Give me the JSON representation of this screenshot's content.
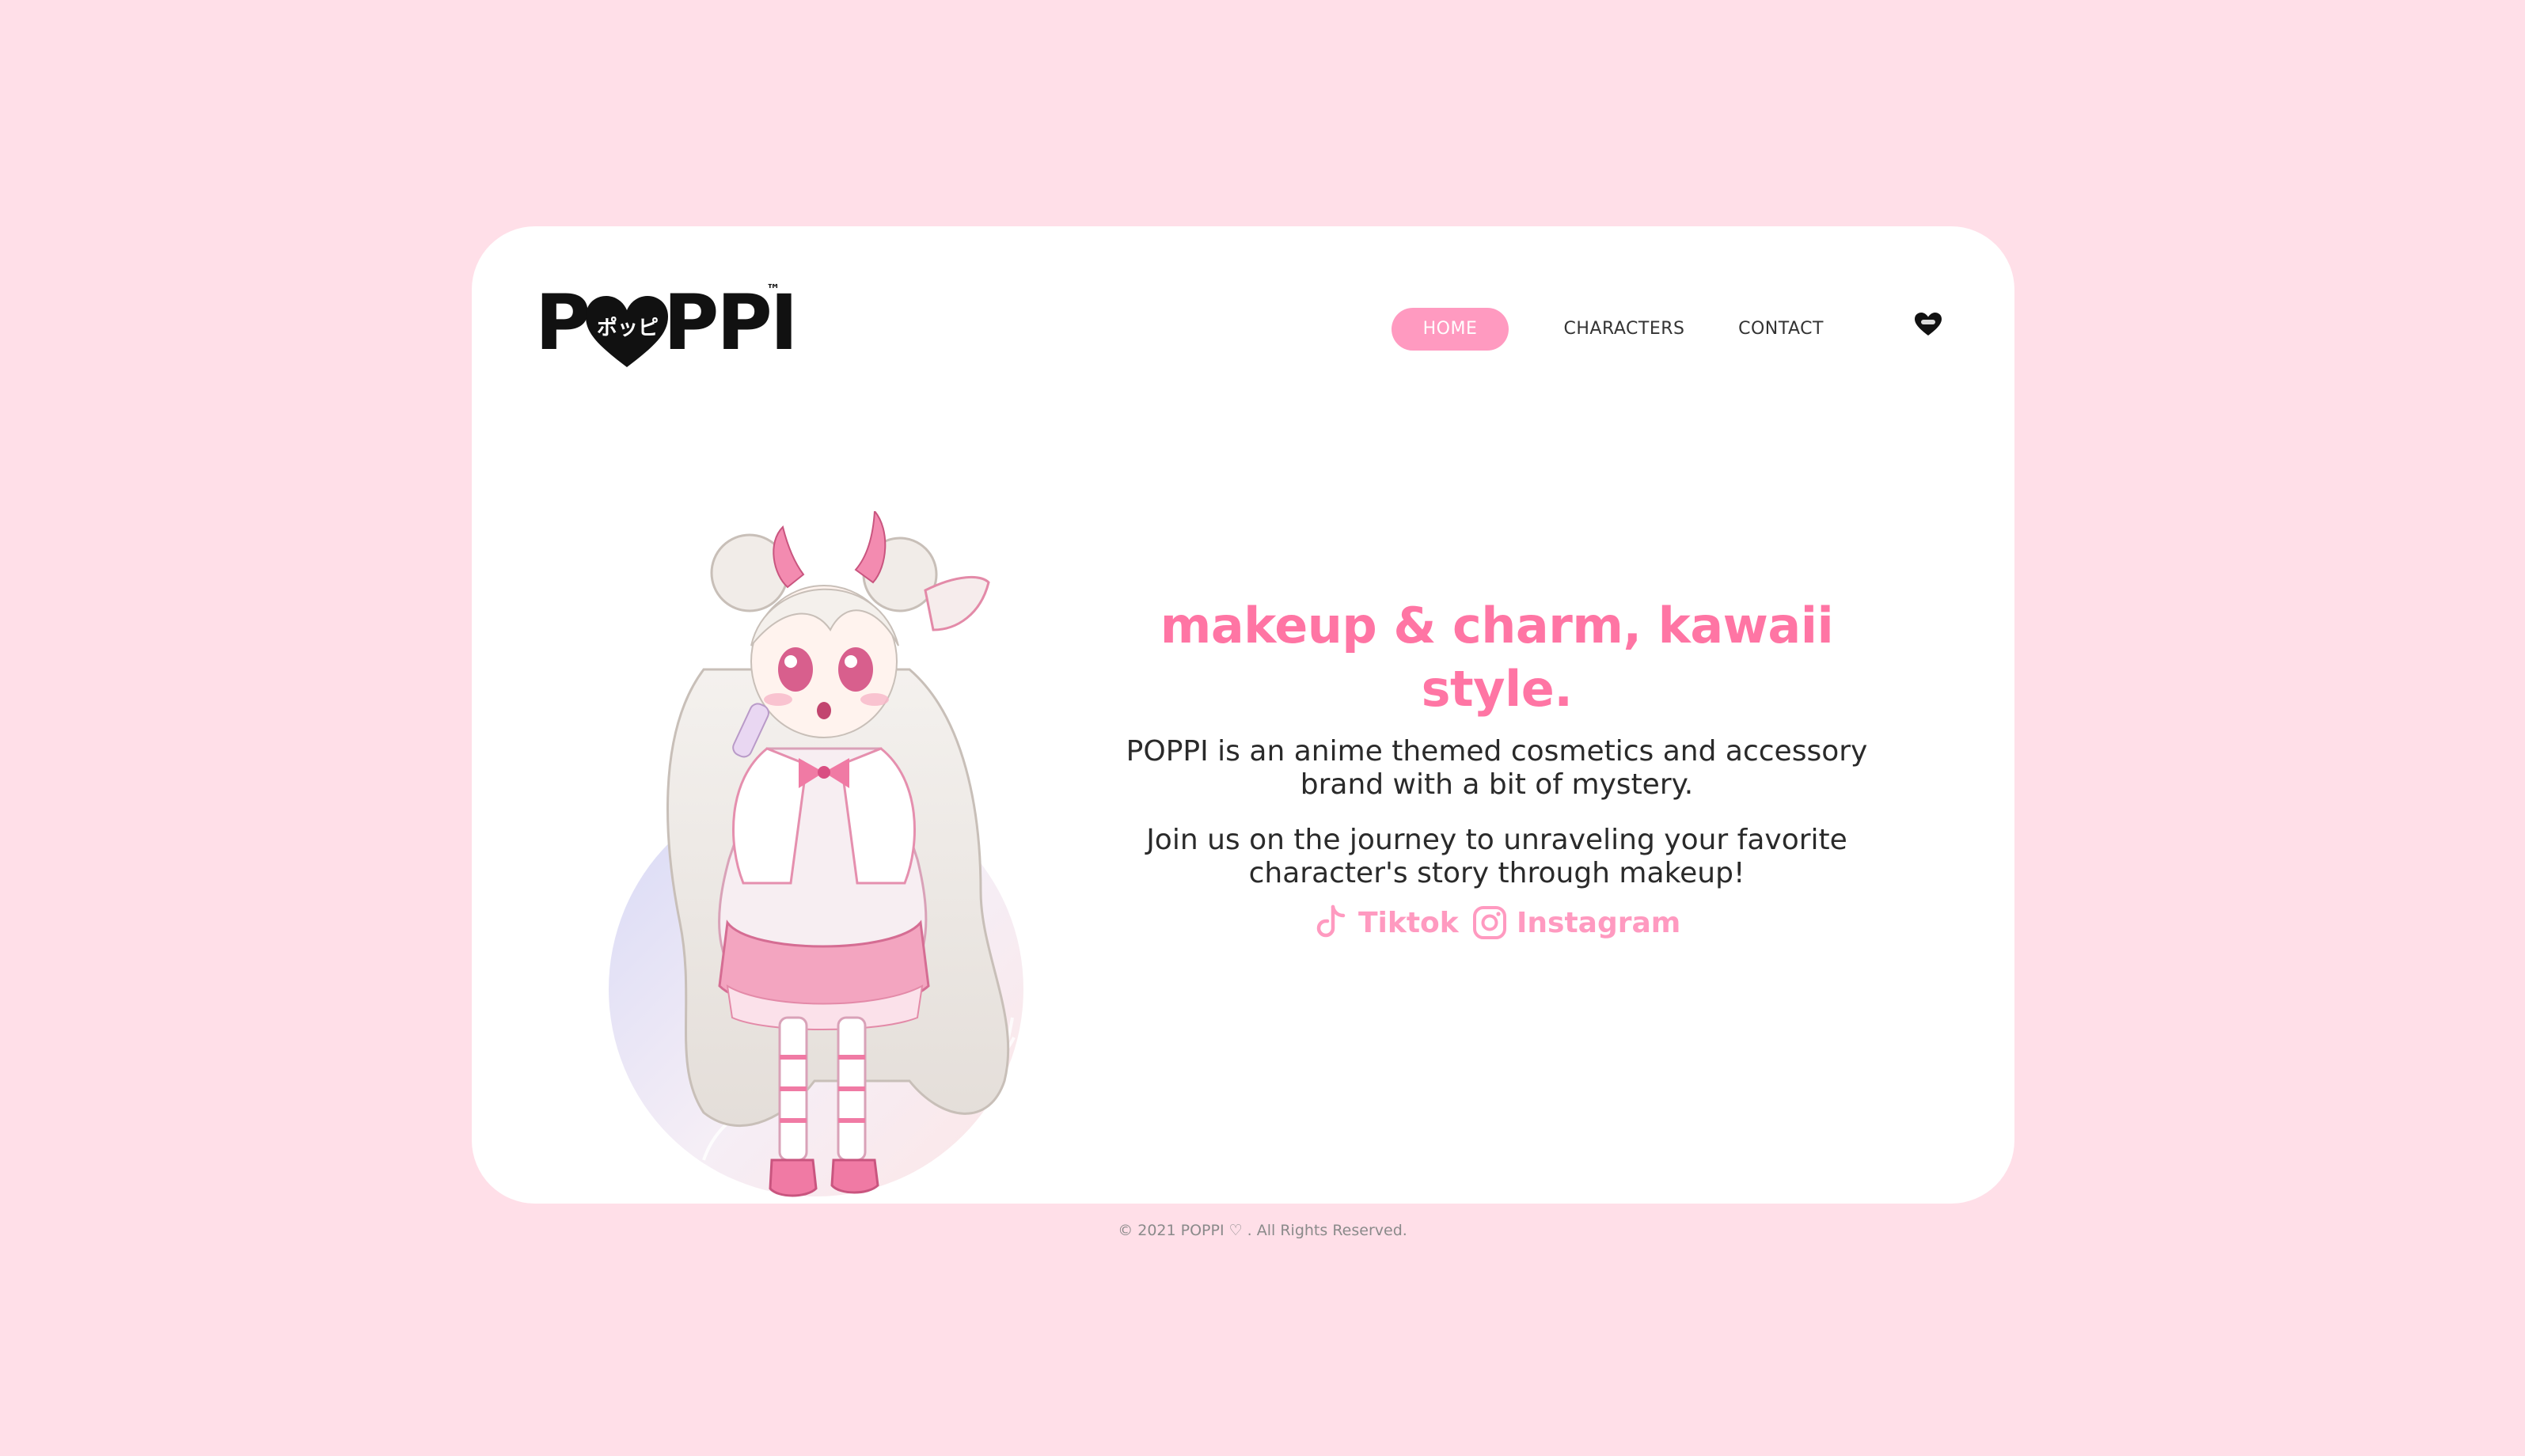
{
  "logo": {
    "wordmark_left": "P",
    "wordmark_right": "PPI",
    "kana": "ポッピ",
    "trademark": "™",
    "icon": "heart-logo-icon"
  },
  "nav": {
    "items": [
      {
        "label": "HOME",
        "active": true
      },
      {
        "label": "CHARACTERS",
        "active": false
      },
      {
        "label": "CONTACT",
        "active": false
      }
    ],
    "heart_icon": "poppi-heart-icon"
  },
  "hero": {
    "title": "makeup & charm, kawaii style.",
    "paragraph1": "POPPI is an anime themed cosmetics and accessory brand with a bit of mystery.",
    "paragraph2": "Join us on the journey to unraveling your favorite character's story through makeup!"
  },
  "socials": [
    {
      "label": "Tiktok",
      "icon": "tiktok-icon"
    },
    {
      "label": "Instagram",
      "icon": "instagram-icon"
    }
  ],
  "footer": {
    "text": "© 2021 POPPI ♡ . All Rights Reserved."
  },
  "colors": {
    "background": "#ffdfe8",
    "card": "#ffffff",
    "accent": "#ff75a4",
    "accent_light": "#ff9ac0",
    "text": "#2a2a2a"
  }
}
